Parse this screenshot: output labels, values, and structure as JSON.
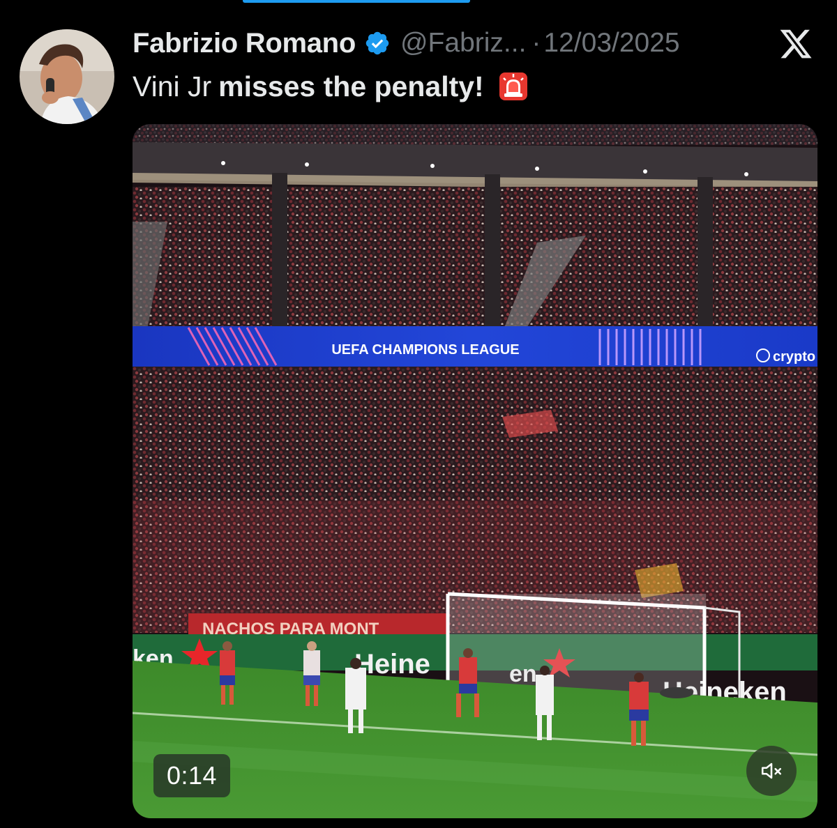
{
  "tweet": {
    "author_name": "Fabrizio Romano",
    "handle": "@Fabriz...",
    "separator": "·",
    "date": "12/03/2025",
    "text_plain": "Vini Jr",
    "text_bold": "misses the penalty!",
    "emoji_icon": "siren-icon",
    "verified_icon": "verified-badge-icon",
    "platform_icon": "x-logo-icon"
  },
  "video": {
    "duration": "0:14",
    "mute_icon": "speaker-muted-icon",
    "led_board_text": "UEFA CHAMPIONS LEAGUE",
    "led_board_sponsor": "crypto",
    "ad_board_text_left": "ken",
    "ad_board_text_mid": "Heine",
    "ad_board_text_mid2": "en",
    "ad_board_text_right": "Heineken",
    "fan_banner_text": "NACHOS PARA MONT"
  },
  "colors": {
    "background": "#000000",
    "primary_text": "#e7e9ea",
    "secondary_text": "#71767b",
    "verified_blue": "#1d9bf0",
    "pitch_green": "#3f8a2c",
    "ucl_blue": "#1f3fc8"
  }
}
